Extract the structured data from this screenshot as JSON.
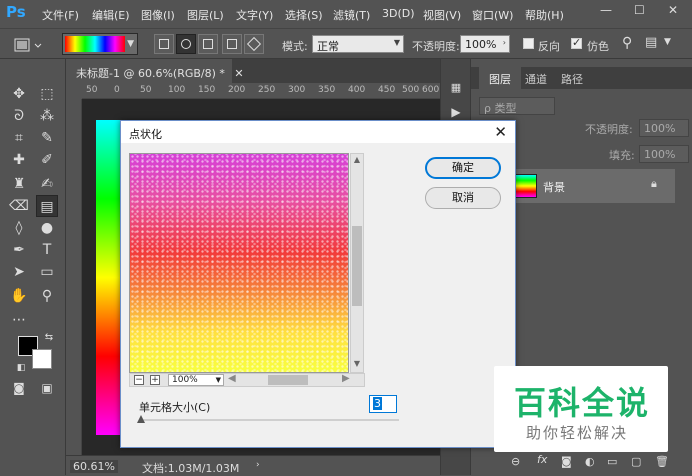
{
  "app": {
    "logo": "Ps"
  },
  "menu": [
    "文件(F)",
    "编辑(E)",
    "图像(I)",
    "图层(L)",
    "文字(Y)",
    "选择(S)",
    "滤镜(T)",
    "3D(D)",
    "视图(V)",
    "窗口(W)",
    "帮助(H)"
  ],
  "window_controls": {
    "minimize": "—",
    "maximize": "☐",
    "close": "✕"
  },
  "options": {
    "mode_label": "模式:",
    "mode_value": "正常",
    "opacity_label": "不透明度:",
    "opacity_value": "100%",
    "reverse_label": "反向",
    "dither_label": "仿色",
    "dither_checked": true,
    "reverse_checked": false
  },
  "document": {
    "tab_title": "未标题-1 @ 60.6%(RGB/8) *",
    "ruler_ticks": [
      "50",
      "0",
      "50",
      "100",
      "150",
      "200",
      "250",
      "300",
      "350",
      "400",
      "450",
      "500",
      "550",
      "600"
    ],
    "zoom": "60.61%",
    "doc_info": "文档:1.03M/1.03M"
  },
  "layers_panel": {
    "tabs": [
      "图层",
      "通道",
      "路径"
    ],
    "active_tab": "图层",
    "filter_label": "ρ 类型",
    "opacity_label": "不透明度:",
    "opacity_value": "100%",
    "fill_label": "填充:",
    "fill_value": "100%",
    "layer_name": "背景"
  },
  "dialog": {
    "title": "点状化",
    "ok_label": "确定",
    "cancel_label": "取消",
    "zoom": "100%",
    "cell_size_label": "单元格大小(C)",
    "cell_size_value": "3"
  },
  "watermark": {
    "big": "百科全说",
    "small": "助你轻松解决"
  },
  "colors": {
    "accent": "#0078d7",
    "watermark_green": "#1db36a",
    "ps_blue": "#31a8ff"
  }
}
